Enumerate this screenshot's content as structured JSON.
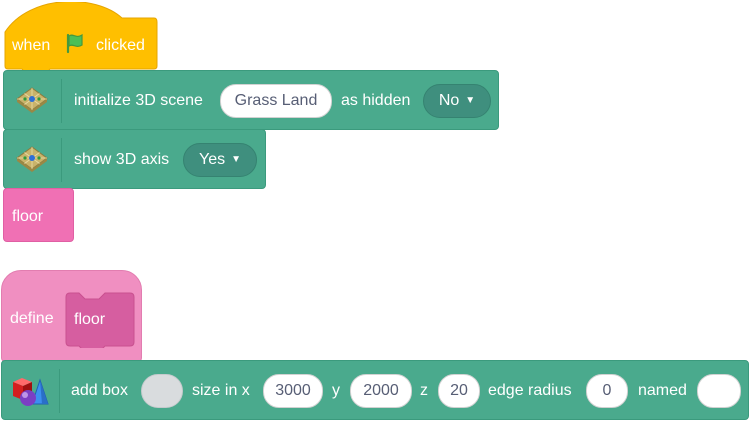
{
  "script1": {
    "hat": {
      "word1": "when",
      "flag_icon": "green-flag-icon",
      "word2": "clicked"
    },
    "init_block": {
      "icon": "3d-grid-tile-icon",
      "label": "initialize 3D scene",
      "scene_value": "Grass Land",
      "hidden_label": "as hidden",
      "hidden_value": "No"
    },
    "axis_block": {
      "icon": "3d-grid-tile-icon",
      "label": "show 3D axis",
      "axis_value": "Yes"
    },
    "call_block": {
      "label": "floor"
    }
  },
  "script2": {
    "define_hat": {
      "label": "define",
      "proc_name": "floor"
    },
    "box_block": {
      "icon": "3d-shapes-icon",
      "label": "add box",
      "color_value": "",
      "size_label": "size in x",
      "x_value": "3000",
      "y_label": "y",
      "y_value": "2000",
      "z_label": "z",
      "z_value": "20",
      "radius_label": "edge radius",
      "radius_value": "0",
      "named_label": "named",
      "name_value": ""
    }
  },
  "colors": {
    "events": "#ffbf00",
    "extension": "#4aaa8d",
    "custom": "#ff6680",
    "define": "#f08fc1",
    "dropdown": "#3f8f7e"
  }
}
